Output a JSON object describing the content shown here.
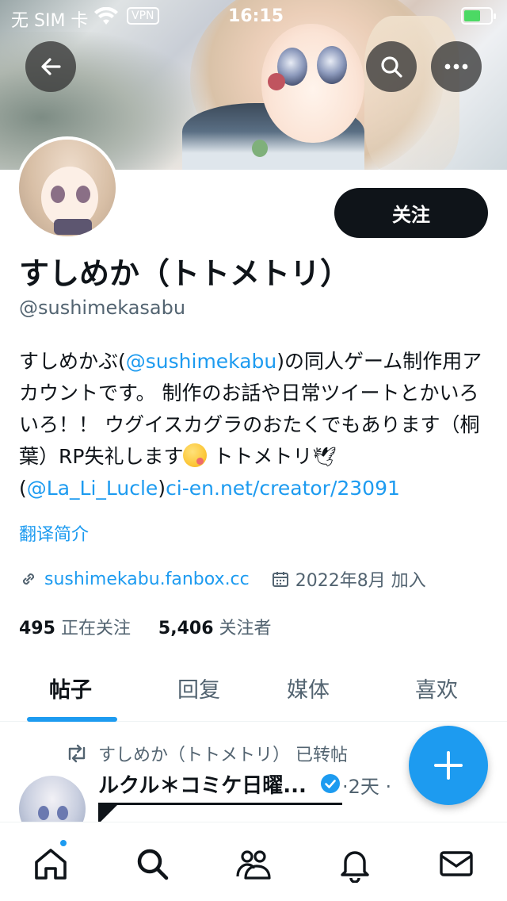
{
  "status_bar": {
    "carrier": "无 SIM 卡",
    "vpn": "VPN",
    "time": "16:15"
  },
  "profile": {
    "display_name": "すしめか（トトメトリ）",
    "handle": "@sushimekasabu",
    "follow_label": "关注",
    "bio": {
      "part1": "すしめかぶ(",
      "mention1": "@sushimekabu",
      "part2": ")の同人ゲーム制作用アカウントです。 制作のお話や日常ツイートとかいろいろ！！ ウグイスカグラのおたくでもあります（桐葉）RP失礼します",
      "part3": " トトメトリ",
      "part4": "(",
      "mention2": "@La_Li_Lucle",
      "part5": ")",
      "link": "ci-en.net/creator/23091"
    },
    "translate_label": "翻译简介",
    "website": "sushimekabu.fanbox.cc",
    "joined": "2022年8月 加入",
    "following_count": "495",
    "following_label": "正在关注",
    "followers_count": "5,406",
    "followers_label": "关注者"
  },
  "tabs": [
    {
      "label": "帖子",
      "active": true
    },
    {
      "label": "回复",
      "active": false
    },
    {
      "label": "媒体",
      "active": false
    },
    {
      "label": "喜欢",
      "active": false
    }
  ],
  "post": {
    "repost_text": "すしめか（トトメトリ） 已转帖",
    "author": "ルクル＊コミケ日曜...",
    "time": "·2天 ·"
  },
  "colors": {
    "accent": "#1d9bf0",
    "text": "#0f1419",
    "secondary": "#536471"
  }
}
